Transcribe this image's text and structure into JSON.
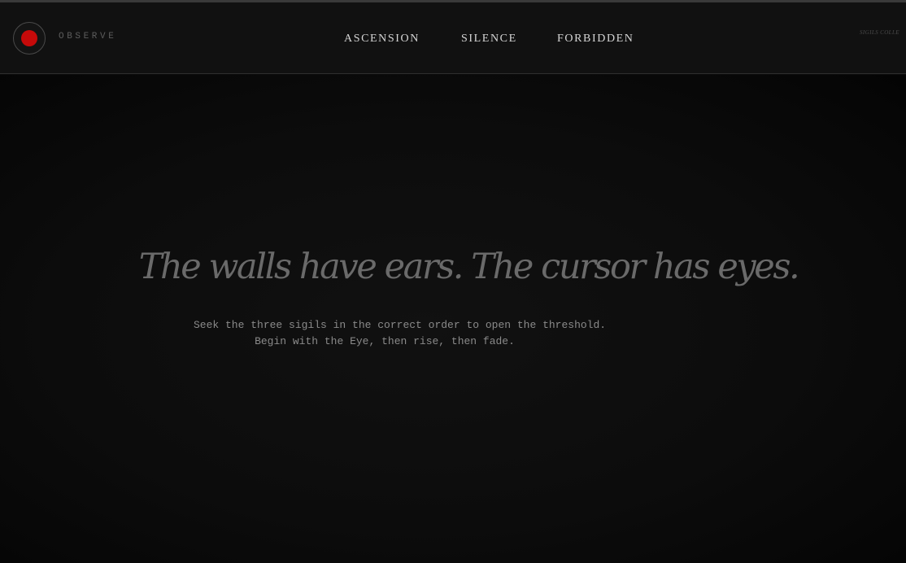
{
  "header": {
    "brand": "OBSERVE",
    "nav": [
      {
        "label": "ASCENSION"
      },
      {
        "label": "SILENCE"
      },
      {
        "label": "FORBIDDEN"
      }
    ],
    "status": "SIGILS COLLE"
  },
  "hero": {
    "headline": "The walls have ears. The cursor has eyes.",
    "instructions": [
      "Seek the three sigils in the correct order to open the threshold.",
      "Begin with the Eye, then rise, then fade."
    ]
  },
  "colors": {
    "background": "#0b0b0b",
    "header_background": "#111111",
    "eye_red": "#c60a0a"
  },
  "icons": {
    "eye_button": "eye-icon"
  }
}
